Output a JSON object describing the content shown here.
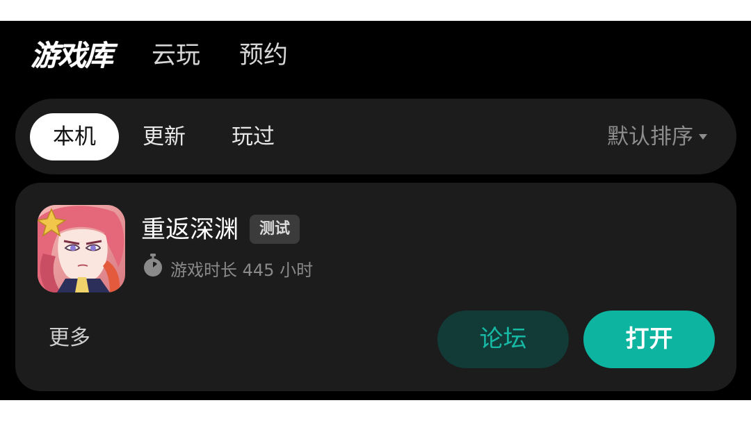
{
  "top_tabs": [
    {
      "label": "游戏库",
      "active": true
    },
    {
      "label": "云玩",
      "active": false
    },
    {
      "label": "预约",
      "active": false
    }
  ],
  "filters": {
    "chips": [
      {
        "label": "本机",
        "active": true
      },
      {
        "label": "更新",
        "active": false
      },
      {
        "label": "玩过",
        "active": false
      }
    ],
    "sort_label": "默认排序"
  },
  "game": {
    "title": "重返深渊",
    "badge": "测试",
    "playtime_text": "游戏时长 445 小时",
    "more_label": "更多",
    "forum_label": "论坛",
    "open_label": "打开"
  },
  "colors": {
    "accent": "#11b7a4",
    "background": "#000000",
    "card": "#1c1c1c"
  }
}
